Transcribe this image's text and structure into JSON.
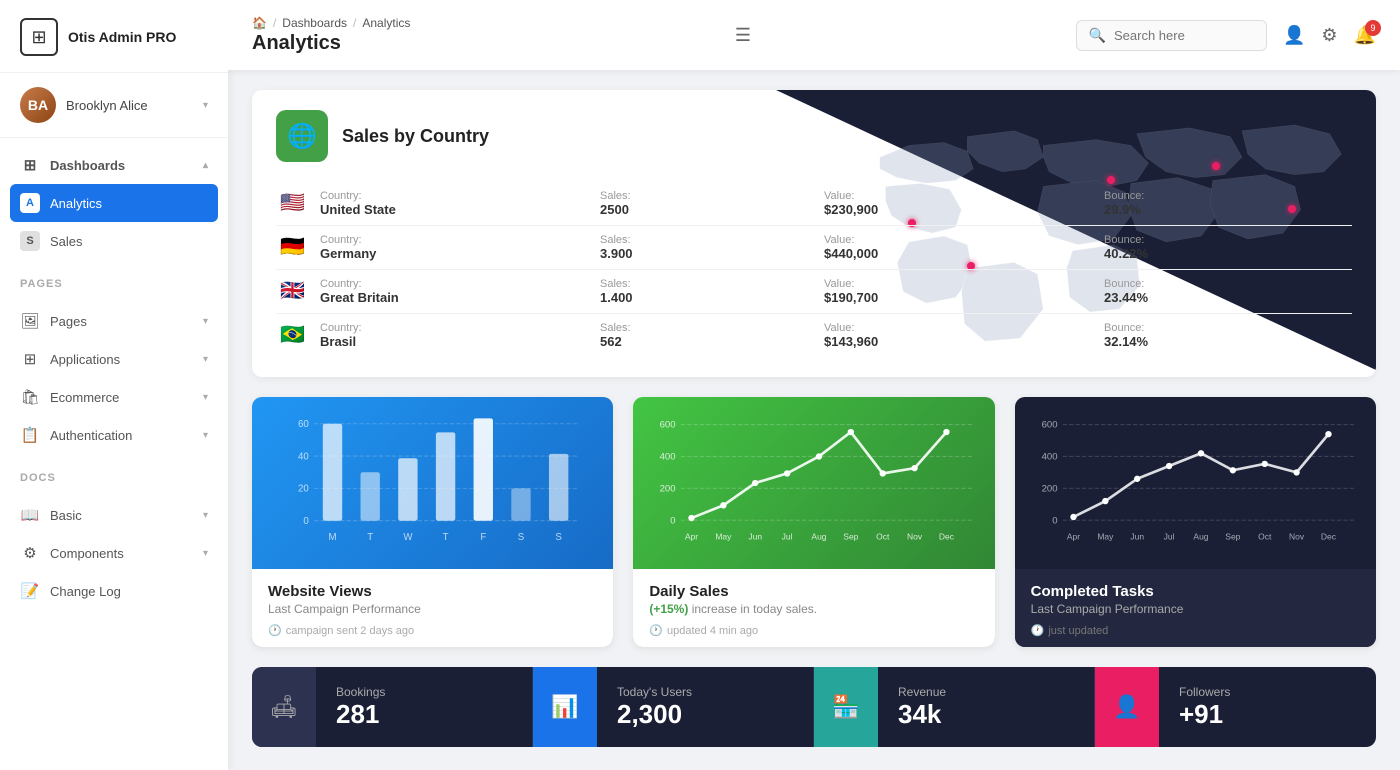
{
  "app": {
    "name": "Otis Admin PRO"
  },
  "sidebar": {
    "user": {
      "name": "Brooklyn Alice",
      "initials": "BA"
    },
    "nav": [
      {
        "id": "dashboards",
        "label": "Dashboards",
        "icon": "⊞",
        "type": "parent",
        "expanded": true
      },
      {
        "id": "analytics",
        "label": "Analytics",
        "icon": "A",
        "type": "child",
        "active": true
      },
      {
        "id": "sales",
        "label": "Sales",
        "icon": "S",
        "type": "child"
      }
    ],
    "pages_section": "PAGES",
    "pages": [
      {
        "id": "pages",
        "label": "Pages",
        "icon": "🖼"
      },
      {
        "id": "applications",
        "label": "Applications",
        "icon": "⊞"
      },
      {
        "id": "ecommerce",
        "label": "Ecommerce",
        "icon": "🛍"
      },
      {
        "id": "authentication",
        "label": "Authentication",
        "icon": "📋"
      }
    ],
    "docs_section": "DOCS",
    "docs": [
      {
        "id": "basic",
        "label": "Basic",
        "icon": "📖"
      },
      {
        "id": "components",
        "label": "Components",
        "icon": "⚙"
      },
      {
        "id": "changelog",
        "label": "Change Log",
        "icon": "📝"
      }
    ]
  },
  "header": {
    "breadcrumb": [
      "🏠",
      "/",
      "Dashboards",
      "/",
      "Analytics"
    ],
    "title": "Analytics",
    "search_placeholder": "Search here",
    "notification_count": "9"
  },
  "sales_card": {
    "title": "Sales by Country",
    "icon": "🌐",
    "countries": [
      {
        "flag": "us",
        "country_label": "Country:",
        "country": "United State",
        "sales_label": "Sales:",
        "sales": "2500",
        "value_label": "Value:",
        "value": "$230,900",
        "bounce_label": "Bounce:",
        "bounce": "29.9%"
      },
      {
        "flag": "de",
        "country_label": "Country:",
        "country": "Germany",
        "sales_label": "Sales:",
        "sales": "3.900",
        "value_label": "Value:",
        "value": "$440,000",
        "bounce_label": "Bounce:",
        "bounce": "40.22%"
      },
      {
        "flag": "gb",
        "country_label": "Country:",
        "country": "Great Britain",
        "sales_label": "Sales:",
        "sales": "1.400",
        "value_label": "Value:",
        "value": "$190,700",
        "bounce_label": "Bounce:",
        "bounce": "23.44%"
      },
      {
        "flag": "br",
        "country_label": "Country:",
        "country": "Brasil",
        "sales_label": "Sales:",
        "sales": "562",
        "value_label": "Value:",
        "value": "$143,960",
        "bounce_label": "Bounce:",
        "bounce": "32.14%"
      }
    ]
  },
  "charts": [
    {
      "id": "website-views",
      "name": "Website Views",
      "sub": "Last Campaign Performance",
      "footer": "campaign sent 2 days ago",
      "type": "bar",
      "color": "blue",
      "x_labels": [
        "M",
        "T",
        "W",
        "T",
        "F",
        "S",
        "S"
      ],
      "y_labels": [
        "0",
        "20",
        "40",
        "60"
      ],
      "bars": [
        55,
        25,
        35,
        50,
        60,
        18,
        38
      ]
    },
    {
      "id": "daily-sales",
      "name": "Daily Sales",
      "sub_highlight": "(+15%)",
      "sub": " increase in today sales.",
      "footer": "updated 4 min ago",
      "type": "line",
      "color": "green",
      "x_labels": [
        "Apr",
        "May",
        "Jun",
        "Jul",
        "Aug",
        "Sep",
        "Oct",
        "Nov",
        "Dec"
      ],
      "y_labels": [
        "0",
        "200",
        "400",
        "600"
      ],
      "points": [
        10,
        80,
        200,
        260,
        350,
        490,
        260,
        290,
        490
      ]
    },
    {
      "id": "completed-tasks",
      "name": "Completed Tasks",
      "sub": "Last Campaign Performance",
      "footer": "just updated",
      "type": "line",
      "color": "dark",
      "x_labels": [
        "Apr",
        "May",
        "Jun",
        "Jul",
        "Aug",
        "Sep",
        "Oct",
        "Nov",
        "Dec"
      ],
      "y_labels": [
        "0",
        "200",
        "400",
        "600"
      ],
      "points": [
        20,
        120,
        260,
        340,
        420,
        310,
        350,
        300,
        480
      ]
    }
  ],
  "stats": [
    {
      "icon": "🛋",
      "icon_color": "gray",
      "label": "Bookings",
      "value": "281"
    },
    {
      "icon": "📊",
      "icon_color": "blue",
      "label": "Today's Users",
      "value": "2,300"
    },
    {
      "icon": "🏪",
      "icon_color": "teal",
      "label": "Revenue",
      "value": "34k"
    },
    {
      "icon": "👤",
      "icon_color": "pink",
      "label": "Followers",
      "value": "+91"
    }
  ]
}
